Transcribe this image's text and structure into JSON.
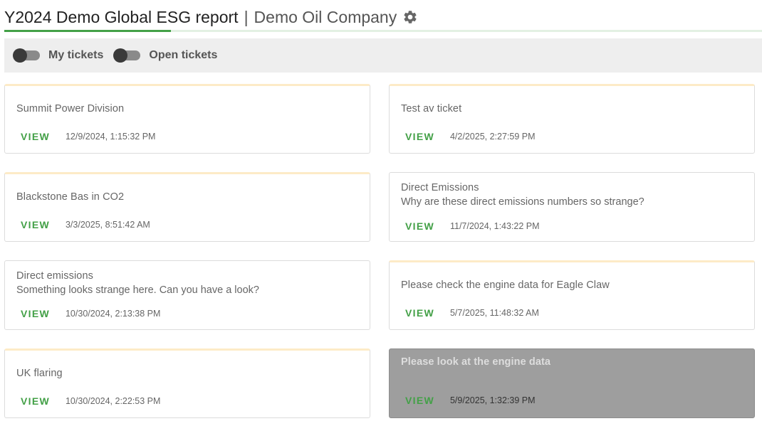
{
  "header": {
    "title": "Y2024 Demo Global ESG report",
    "separator": "|",
    "company": "Demo Oil Company",
    "settings_icon": "gear-icon",
    "progress_percent": 22
  },
  "filters": [
    {
      "label": "My tickets",
      "on": false
    },
    {
      "label": "Open tickets",
      "on": false
    }
  ],
  "view_label": "VIEW",
  "tickets": [
    {
      "title": "Summit Power Division",
      "description": "",
      "timestamp": "12/9/2024, 1:15:32 PM"
    },
    {
      "title": "Test av ticket",
      "description": "",
      "timestamp": "4/2/2025, 2:27:59 PM"
    },
    {
      "title": "Blackstone Bas in CO2",
      "description": "",
      "timestamp": "3/3/2025, 8:51:42 AM"
    },
    {
      "title": "Direct Emissions",
      "description": "Why are these direct emissions numbers so strange?",
      "timestamp": "11/7/2024, 1:43:22 PM"
    },
    {
      "title": "Direct emissions",
      "description": "Something looks strange here. Can you have a look?",
      "timestamp": "10/30/2024, 2:13:38 PM"
    },
    {
      "title": "Please check the engine data for Eagle Claw",
      "description": "",
      "timestamp": "5/7/2025, 11:48:32 AM"
    },
    {
      "title": "UK flaring",
      "description": "",
      "timestamp": "10/30/2024, 2:22:53 PM"
    },
    {
      "title": "Please look at the engine data",
      "description": "",
      "timestamp": "5/9/2025, 1:32:39 PM"
    }
  ],
  "colors": {
    "accent_green": "#43a047",
    "selected_card": "#9e9e9e",
    "filter_bar": "#eeeeee"
  }
}
